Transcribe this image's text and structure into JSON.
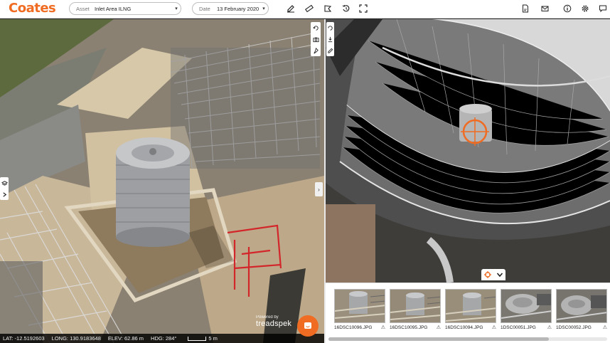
{
  "brand": {
    "name": "Coates",
    "color": "#ef6c22"
  },
  "toolbar": {
    "asset_label": "Asset",
    "asset_value": "Inlet Area ILNG",
    "date_label": "Date",
    "date_value": "13 February 2020",
    "left_tools": [
      "edit-icon",
      "measure-ruler-icon",
      "polygon-icon",
      "history-icon",
      "fullscreen-icon"
    ],
    "right_tools": [
      "pdf-icon",
      "email-icon",
      "info-icon",
      "settings-icon",
      "chat-icon"
    ]
  },
  "model_view": {
    "side_controls": [
      "rotate-icon",
      "camera-icon",
      "pin-icon"
    ],
    "status": {
      "lat": "LAT: -12.5192603",
      "long": "LONG: 130.9183648",
      "elev": "ELEV: 62.86 m",
      "hdg": "HDG: 284°",
      "scale": "5 m"
    },
    "powered_line1": "Powered by",
    "powered_line2": "treadspek"
  },
  "photo_view": {
    "thumbnails": [
      {
        "filename": "16DSC10096.JPG"
      },
      {
        "filename": "16DSC10095.JPG"
      },
      {
        "filename": "16DSC10094.JPG"
      },
      {
        "filename": "1DSC00051.JPG"
      },
      {
        "filename": "1DSC00052.JPG"
      }
    ]
  }
}
